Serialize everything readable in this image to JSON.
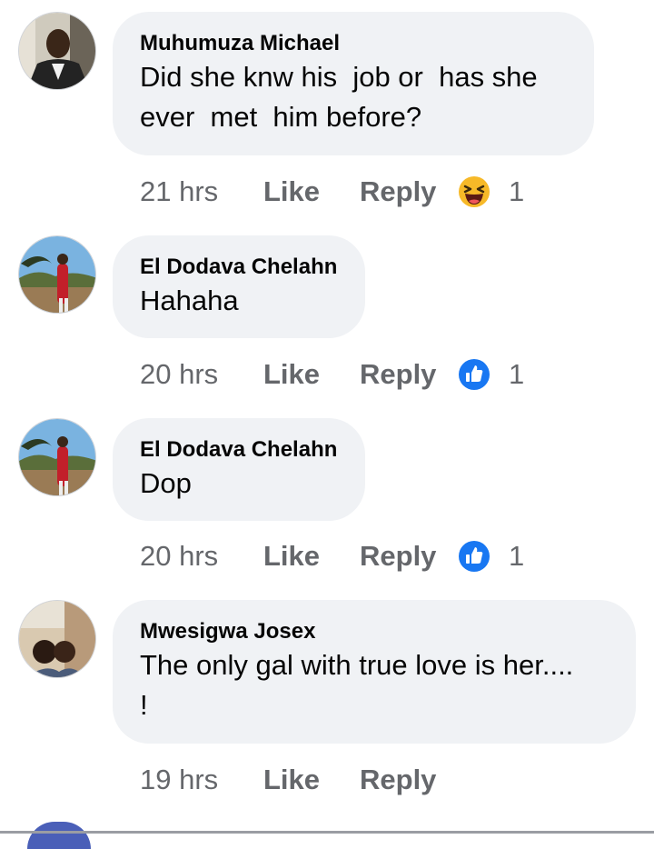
{
  "comments": [
    {
      "author": "Muhumuza Michael",
      "text": "Did she knw his  job or  has she\never  met  him before?",
      "time": "21 hrs",
      "like_label": "Like",
      "reply_label": "Reply",
      "reaction": {
        "icon": "haha-emoji-icon",
        "count": "1"
      }
    },
    {
      "author": "El Dodava Chelahn",
      "text": "Hahaha",
      "time": "20 hrs",
      "like_label": "Like",
      "reply_label": "Reply",
      "reaction": {
        "icon": "thumbs-up-icon",
        "count": "1"
      }
    },
    {
      "author": "El Dodava Chelahn",
      "text": "Dop",
      "time": "20 hrs",
      "like_label": "Like",
      "reply_label": "Reply",
      "reaction": {
        "icon": "thumbs-up-icon",
        "count": "1"
      }
    },
    {
      "author": "Mwesigwa Josex",
      "text": "The only gal with true love is her....\n!",
      "time": "19 hrs",
      "like_label": "Like",
      "reply_label": "Reply"
    }
  ],
  "colors": {
    "bubble": "#f0f2f5",
    "meta_text": "#65676b",
    "like_blue": "#1877f2",
    "haha_yellow": "#f7b928"
  }
}
